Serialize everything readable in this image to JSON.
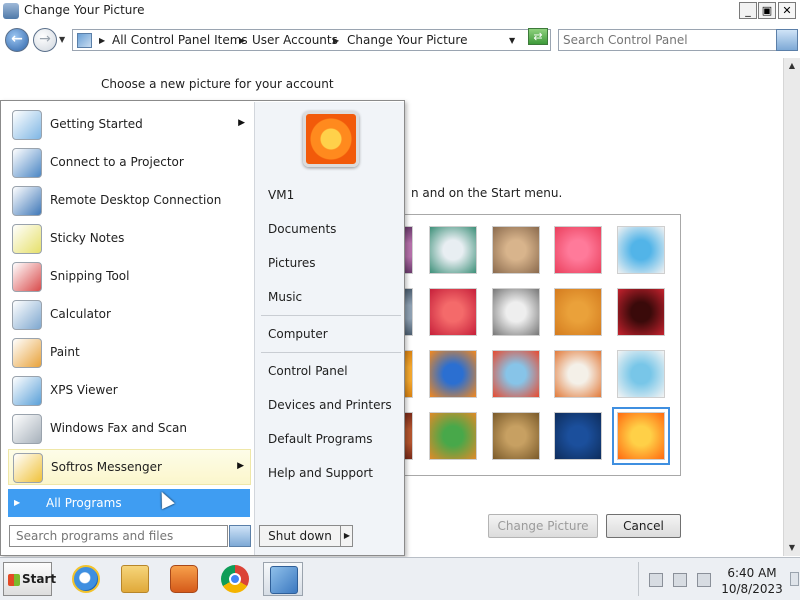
{
  "window": {
    "title": "Change Your Picture",
    "minimize_glyph": "_",
    "maximize_glyph": "▣",
    "close_glyph": "✕"
  },
  "navbar": {
    "back_glyph": "←",
    "forward_glyph": "→",
    "breadcrumbs": [
      "All Control Panel Items",
      "User Accounts",
      "Change Your Picture"
    ],
    "search_placeholder": "Search Control Panel"
  },
  "page": {
    "heading": "Choose a new picture for your account",
    "description_partial": "n and on the Start menu.",
    "pictures": [
      {
        "icon": "flower-partial-picture",
        "colors": [
          "#b46fa9",
          "#6b3b6d"
        ]
      },
      {
        "icon": "gyroscope-picture",
        "colors": [
          "#e8eef2",
          "#3c8f78"
        ]
      },
      {
        "icon": "kitten-picture",
        "colors": [
          "#d8b48c",
          "#8a6a4d"
        ]
      },
      {
        "icon": "pink-flower-picture",
        "colors": [
          "#ff7a9a",
          "#ea3f5c"
        ]
      },
      {
        "icon": "ferris-wheel-picture",
        "colors": [
          "#52b4e8",
          "#f2f2f2"
        ]
      },
      {
        "icon": "partial-picture-2",
        "colors": [
          "#8ea0b2",
          "#4c5e70"
        ]
      },
      {
        "icon": "starfish-picture",
        "colors": [
          "#f46a6a",
          "#c61f3a"
        ]
      },
      {
        "icon": "jacks-picture",
        "colors": [
          "#eeeeee",
          "#777777"
        ]
      },
      {
        "icon": "stairs-picture",
        "colors": [
          "#eaa13a",
          "#d47b1e"
        ]
      },
      {
        "icon": "origami-crane-picture",
        "colors": [
          "#3a0a0a",
          "#c6222e"
        ]
      },
      {
        "icon": "partial-picture-3",
        "colors": [
          "#f3a72e",
          "#d98313"
        ]
      },
      {
        "icon": "fish-picture",
        "colors": [
          "#2b6fd1",
          "#f2881e"
        ]
      },
      {
        "icon": "hot-air-balloon-picture",
        "colors": [
          "#87c4e8",
          "#e84a2f"
        ]
      },
      {
        "icon": "doll-picture",
        "colors": [
          "#f4f0e8",
          "#e27a3a"
        ]
      },
      {
        "icon": "sailboat-picture",
        "colors": [
          "#78c6e8",
          "#f4f4f4"
        ]
      },
      {
        "icon": "partial-picture-4",
        "colors": [
          "#b3542e",
          "#7a2b1a"
        ]
      },
      {
        "icon": "butterfly-picture",
        "colors": [
          "#48a84a",
          "#e08a28"
        ]
      },
      {
        "icon": "shell-picture",
        "colors": [
          "#c7a062",
          "#7a5a2a"
        ]
      },
      {
        "icon": "lighthouse-picture",
        "colors": [
          "#1b4f9c",
          "#0e2d5c"
        ]
      },
      {
        "icon": "orange-flower-picture",
        "colors": [
          "#ffd047",
          "#ff6a10"
        ]
      }
    ],
    "change_button": "Change Picture",
    "cancel_button": "Cancel"
  },
  "start_menu": {
    "programs": [
      {
        "label": "Getting Started",
        "icon": "getting-started-icon",
        "color": "#7fb6e4",
        "has_arrow": true
      },
      {
        "label": "Connect to a Projector",
        "icon": "projector-icon",
        "color": "#4a86c4",
        "has_arrow": false
      },
      {
        "label": "Remote Desktop Connection",
        "icon": "remote-desktop-icon",
        "color": "#3f78b8",
        "has_arrow": false
      },
      {
        "label": "Sticky Notes",
        "icon": "sticky-notes-icon",
        "color": "#e6e06a",
        "has_arrow": false
      },
      {
        "label": "Snipping Tool",
        "icon": "snipping-tool-icon",
        "color": "#d94b4b",
        "has_arrow": false
      },
      {
        "label": "Calculator",
        "icon": "calculator-icon",
        "color": "#7ea7cf",
        "has_arrow": false
      },
      {
        "label": "Paint",
        "icon": "paint-icon",
        "color": "#e8a23a",
        "has_arrow": false
      },
      {
        "label": "XPS Viewer",
        "icon": "xps-viewer-icon",
        "color": "#5aa0d8",
        "has_arrow": false
      },
      {
        "label": "Windows Fax and Scan",
        "icon": "fax-scan-icon",
        "color": "#a7b1bb",
        "has_arrow": false
      },
      {
        "label": "Softros Messenger",
        "icon": "messenger-icon",
        "color": "#f0c23a",
        "has_arrow": true
      }
    ],
    "all_programs": "All Programs",
    "search_placeholder": "Search programs and files",
    "right_links": {
      "user": "VM1",
      "documents": "Documents",
      "pictures": "Pictures",
      "music": "Music",
      "computer": "Computer",
      "control_panel": "Control Panel",
      "devices_printers": "Devices and Printers",
      "default_programs": "Default Programs",
      "help_support": "Help and Support"
    },
    "shutdown": "Shut down",
    "shutdown_arrow": "▶"
  },
  "taskbar": {
    "start_label": "Start",
    "apps": [
      "internet-explorer-icon",
      "windows-explorer-icon",
      "media-player-icon",
      "chrome-icon",
      "control-panel-icon"
    ],
    "time": "6:40 AM",
    "date": "10/8/2023"
  },
  "colors": {
    "selection_blue": "#3f9df2",
    "selected_outline": "#3f8fe0"
  }
}
